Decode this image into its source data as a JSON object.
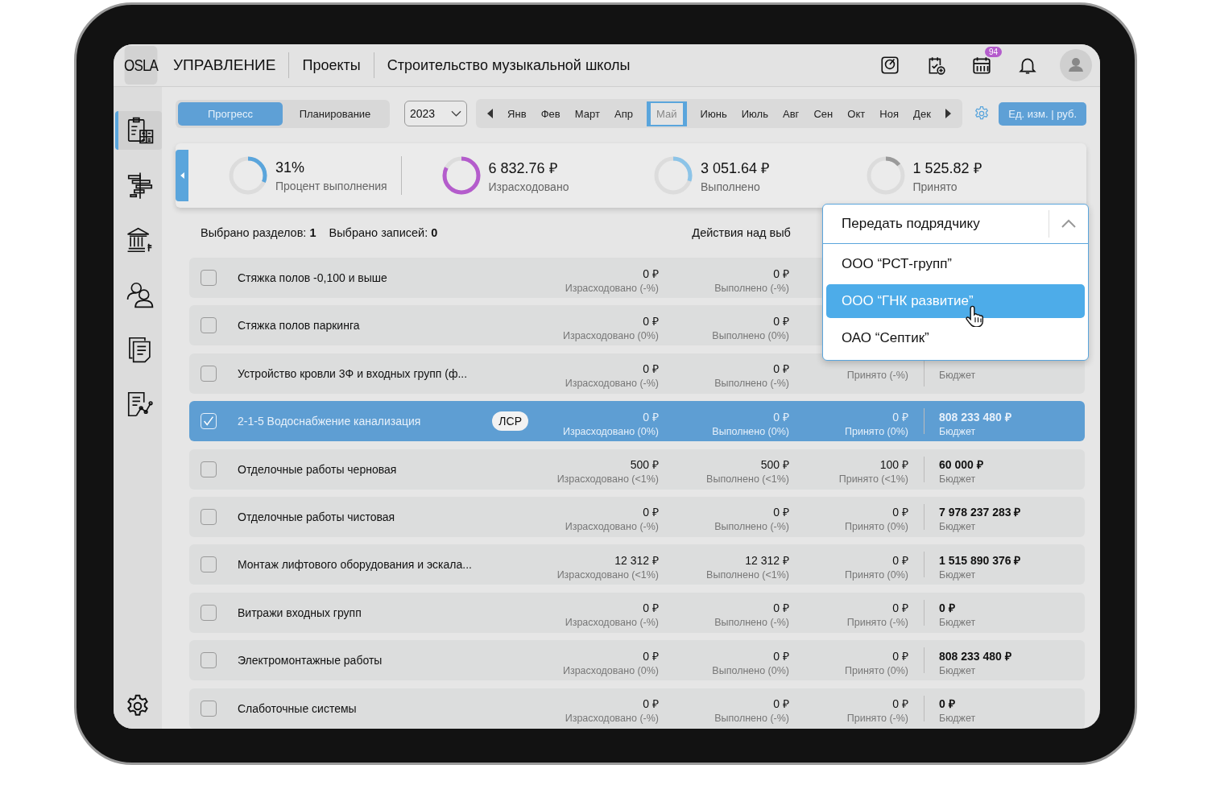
{
  "header": {
    "logo": "OSLA",
    "section": "УПРАВЛЕНИЕ",
    "breadcrumb": "Проекты",
    "title": "Строительство музыкальной школы",
    "notification_badge": "94"
  },
  "sidebar": {
    "items": [
      {
        "selected": true
      },
      {
        "selected": false
      },
      {
        "selected": false
      },
      {
        "selected": false
      },
      {
        "selected": false
      },
      {
        "selected": false
      }
    ]
  },
  "view_tabs": [
    {
      "label": "Прогресс",
      "selected": true
    },
    {
      "label": "Планирование",
      "selected": false
    }
  ],
  "year_select": {
    "value": "2023"
  },
  "months": [
    {
      "label": "Янв",
      "selected": false
    },
    {
      "label": "Фев",
      "selected": false
    },
    {
      "label": "Март",
      "selected": false
    },
    {
      "label": "Апр",
      "selected": false
    },
    {
      "label": "Май",
      "selected": true
    },
    {
      "label": "Июнь",
      "selected": false
    },
    {
      "label": "Июль",
      "selected": false
    },
    {
      "label": "Авг",
      "selected": false
    },
    {
      "label": "Сен",
      "selected": false
    },
    {
      "label": "Окт",
      "selected": false
    },
    {
      "label": "Ноя",
      "selected": false
    },
    {
      "label": "Дек",
      "selected": false
    }
  ],
  "unit_button": "Ед. изм. | руб.",
  "kpis": [
    {
      "value": "31%",
      "label": "Процент выполнения",
      "level": 0.31,
      "color": "#5aa5dc"
    },
    {
      "value": "6 832.76 ₽",
      "label": "Израсходовано",
      "level": 0.82,
      "color": "#b45ccc"
    },
    {
      "value": "3 051.64 ₽",
      "label": "Выполнено",
      "level": 0.3,
      "color": "#8cc4e8"
    },
    {
      "value": "1 525.82 ₽",
      "label": "Принято",
      "level": 0.14,
      "color": "#9a9a9a"
    }
  ],
  "selection_info": [
    "Выбрано разделов: **1**",
    "Выбрано записей: **0**"
  ],
  "actions_label": "Действия над выб",
  "dropdown": {
    "title": "Передать подрядчику",
    "expanded": true,
    "options": [
      {
        "label": "ООО “РСТ-групп”",
        "selected": false
      },
      {
        "label": "ООО “ГНК развитие”",
        "selected": true
      },
      {
        "label": "ОАО “Септик”",
        "selected": false
      }
    ]
  },
  "rows": [
    {
      "name": "Стяжка полов -0,100 и выше",
      "checked": false,
      "selected": false,
      "spent": "0 ₽",
      "spent_label": "Израсходовано (-%)",
      "done": "0 ₽",
      "done_label": "Выполнено (-%)"
    },
    {
      "name": "Стяжка полов паркинга",
      "checked": false,
      "selected": false,
      "spent": "0 ₽",
      "spent_label": "Израсходовано (0%)",
      "done": "0 ₽",
      "done_label": "Выполнено (0%)"
    },
    {
      "name": "Устройство кровли 3Ф и входных групп (ф...",
      "checked": false,
      "selected": false,
      "spent": "0 ₽",
      "spent_label": "Израсходовано (-%)",
      "done": "0 ₽",
      "done_label": "Выполнено (-%)",
      "accepted_label": "Принято (-%)",
      "budget_label": "Бюджет"
    },
    {
      "name": "2-1-5 Водоснабжение канализация",
      "badge": "ЛСР",
      "checked": true,
      "selected": true,
      "spent": "0 ₽",
      "spent_label": "Израсходовано (0%)",
      "done": "0 ₽",
      "done_label": "Выполнено (0%)",
      "accepted": "0 ₽",
      "accepted_label": "Принято (0%)",
      "budget": "808 233 480 ₽",
      "budget_label": "Бюджет"
    },
    {
      "name": "Отделочные работы черновая",
      "checked": false,
      "selected": false,
      "spent": "500 ₽",
      "spent_label": "Израсходовано (<1%)",
      "done": "500 ₽",
      "done_label": "Выполнено (<1%)",
      "accepted": "100 ₽",
      "accepted_label": "Принято (<1%)",
      "budget": "60 000 ₽",
      "budget_label": "Бюджет"
    },
    {
      "name": "Отделочные работы чистовая",
      "checked": false,
      "selected": false,
      "spent": "0 ₽",
      "spent_label": "Израсходовано (-%)",
      "done": "0 ₽",
      "done_label": "Выполнено (-%)",
      "accepted": "0 ₽",
      "accepted_label": "Принято (0%)",
      "budget": "7 978 237 283 ₽",
      "budget_label": "Бюджет"
    },
    {
      "name": "Монтаж лифтового оборудования и эскала...",
      "checked": false,
      "selected": false,
      "spent": "12 312 ₽",
      "spent_label": "Израсходовано (<1%)",
      "done": "12 312 ₽",
      "done_label": "Выполнено (<1%)",
      "accepted": "0 ₽",
      "accepted_label": "Принято (0%)",
      "budget": "1 515 890 376 ₽",
      "budget_label": "Бюджет"
    },
    {
      "name": "Витражи входных групп",
      "checked": false,
      "selected": false,
      "spent": "0 ₽",
      "spent_label": "Израсходовано (-%)",
      "done": "0 ₽",
      "done_label": "Выполнено (-%)",
      "accepted": "0 ₽",
      "accepted_label": "Принято (-%)",
      "budget": "0 ₽",
      "budget_label": "Бюджет"
    },
    {
      "name": "Электромонтажные работы",
      "checked": false,
      "selected": false,
      "spent": "0 ₽",
      "spent_label": "Израсходовано (0%)",
      "done": "0 ₽",
      "done_label": "Выполнено (0%)",
      "accepted": "0 ₽",
      "accepted_label": "Принято (0%)",
      "budget": "808 233 480 ₽",
      "budget_label": "Бюджет"
    },
    {
      "name": "Слаботочные системы",
      "checked": false,
      "selected": false,
      "spent": "0 ₽",
      "spent_label": "Израсходовано (-%)",
      "done": "0 ₽",
      "done_label": "Выполнено (-%)",
      "accepted": "0 ₽",
      "accepted_label": "Принято (-%)",
      "budget": "0 ₽",
      "budget_label": "Бюджет"
    }
  ]
}
